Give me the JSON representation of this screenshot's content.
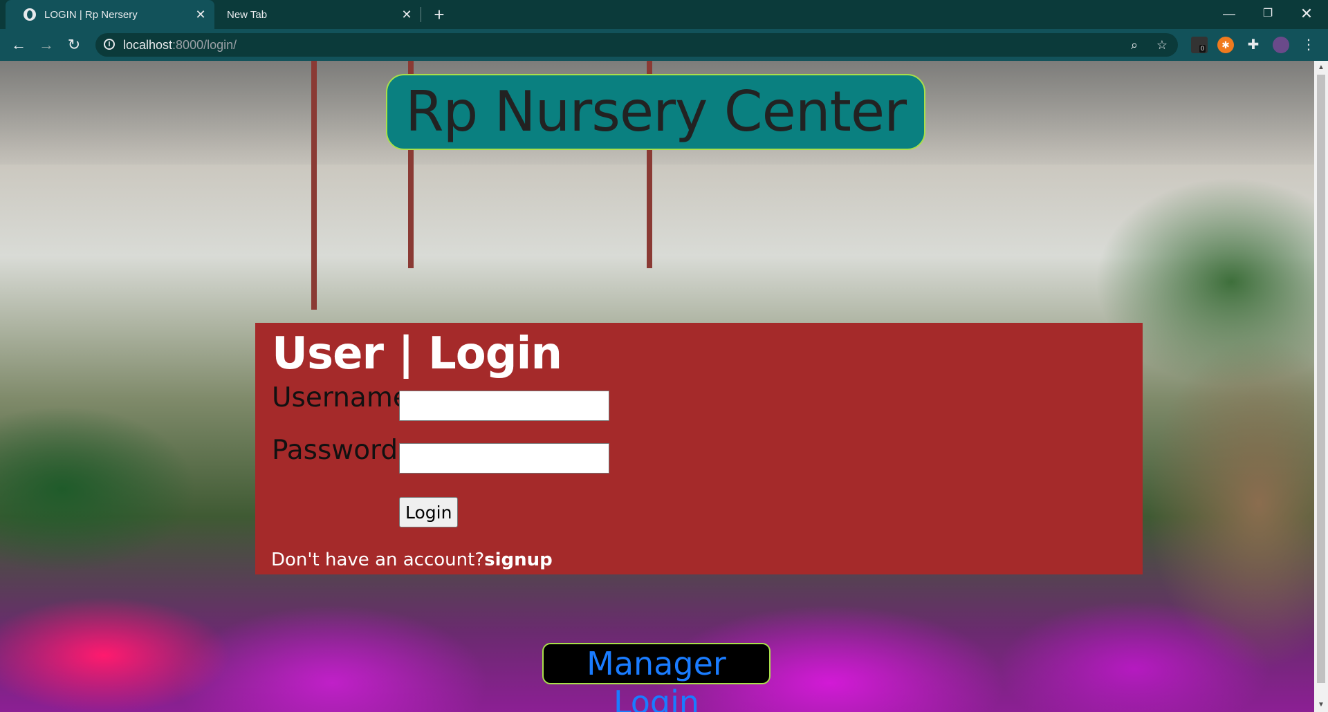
{
  "browser": {
    "tabs": [
      {
        "title": "LOGIN | Rp Nersery",
        "active": true
      },
      {
        "title": "New Tab",
        "active": false
      }
    ],
    "url_host": "localhost",
    "url_path": ":8000/login/",
    "extension_badge": "0"
  },
  "page": {
    "site_title": "Rp Nursery Center",
    "login_heading": "User | Login",
    "username_label": "Username",
    "password_label": "Password",
    "username_value": "",
    "password_value": "",
    "login_button": "Login",
    "signup_prompt": "Don't have an account?",
    "signup_link": "signup",
    "manager_login": "Manager Login"
  },
  "colors": {
    "title_bg": "#0a8080",
    "title_border": "#a9e04a",
    "panel_bg": "#a52a2a",
    "manager_text": "#1a7cff"
  }
}
